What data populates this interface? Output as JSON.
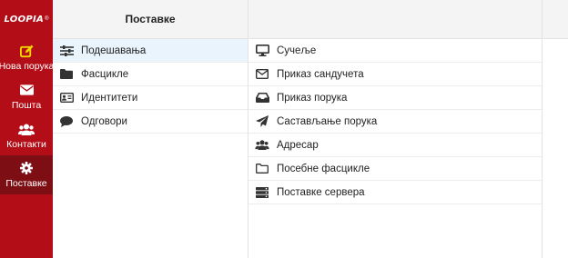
{
  "app": {
    "logo_text": "LOOPIA",
    "logo_mark": "®"
  },
  "sidebar": {
    "items": [
      {
        "label": "Нова порука",
        "icon": "compose-icon"
      },
      {
        "label": "Пошта",
        "icon": "envelope-icon"
      },
      {
        "label": "Контакти",
        "icon": "users-icon"
      },
      {
        "label": "Поставке",
        "icon": "gear-icon",
        "active": true
      }
    ]
  },
  "settings": {
    "title": "Поставке",
    "items": [
      {
        "label": "Подешавања",
        "icon": "sliders-icon",
        "selected": true
      },
      {
        "label": "Фасцикле",
        "icon": "folder-icon"
      },
      {
        "label": "Идентитети",
        "icon": "id-card-icon"
      },
      {
        "label": "Одговори",
        "icon": "comment-icon"
      }
    ]
  },
  "preferences": {
    "items": [
      {
        "label": "Сучеље",
        "icon": "monitor-icon"
      },
      {
        "label": "Приказ сандучета",
        "icon": "envelope-outline-icon"
      },
      {
        "label": "Приказ порука",
        "icon": "inbox-icon"
      },
      {
        "label": "Састављање порука",
        "icon": "paper-plane-icon"
      },
      {
        "label": "Адресар",
        "icon": "users-icon"
      },
      {
        "label": "Посебне фасцикле",
        "icon": "folder-outline-icon"
      },
      {
        "label": "Поставке сервера",
        "icon": "server-icon"
      }
    ]
  },
  "colors": {
    "sidebar_bg": "#b30d17",
    "sidebar_active": "#7d0e14",
    "compose_accent": "#f2d400",
    "selected_row": "#eaf4fc"
  }
}
